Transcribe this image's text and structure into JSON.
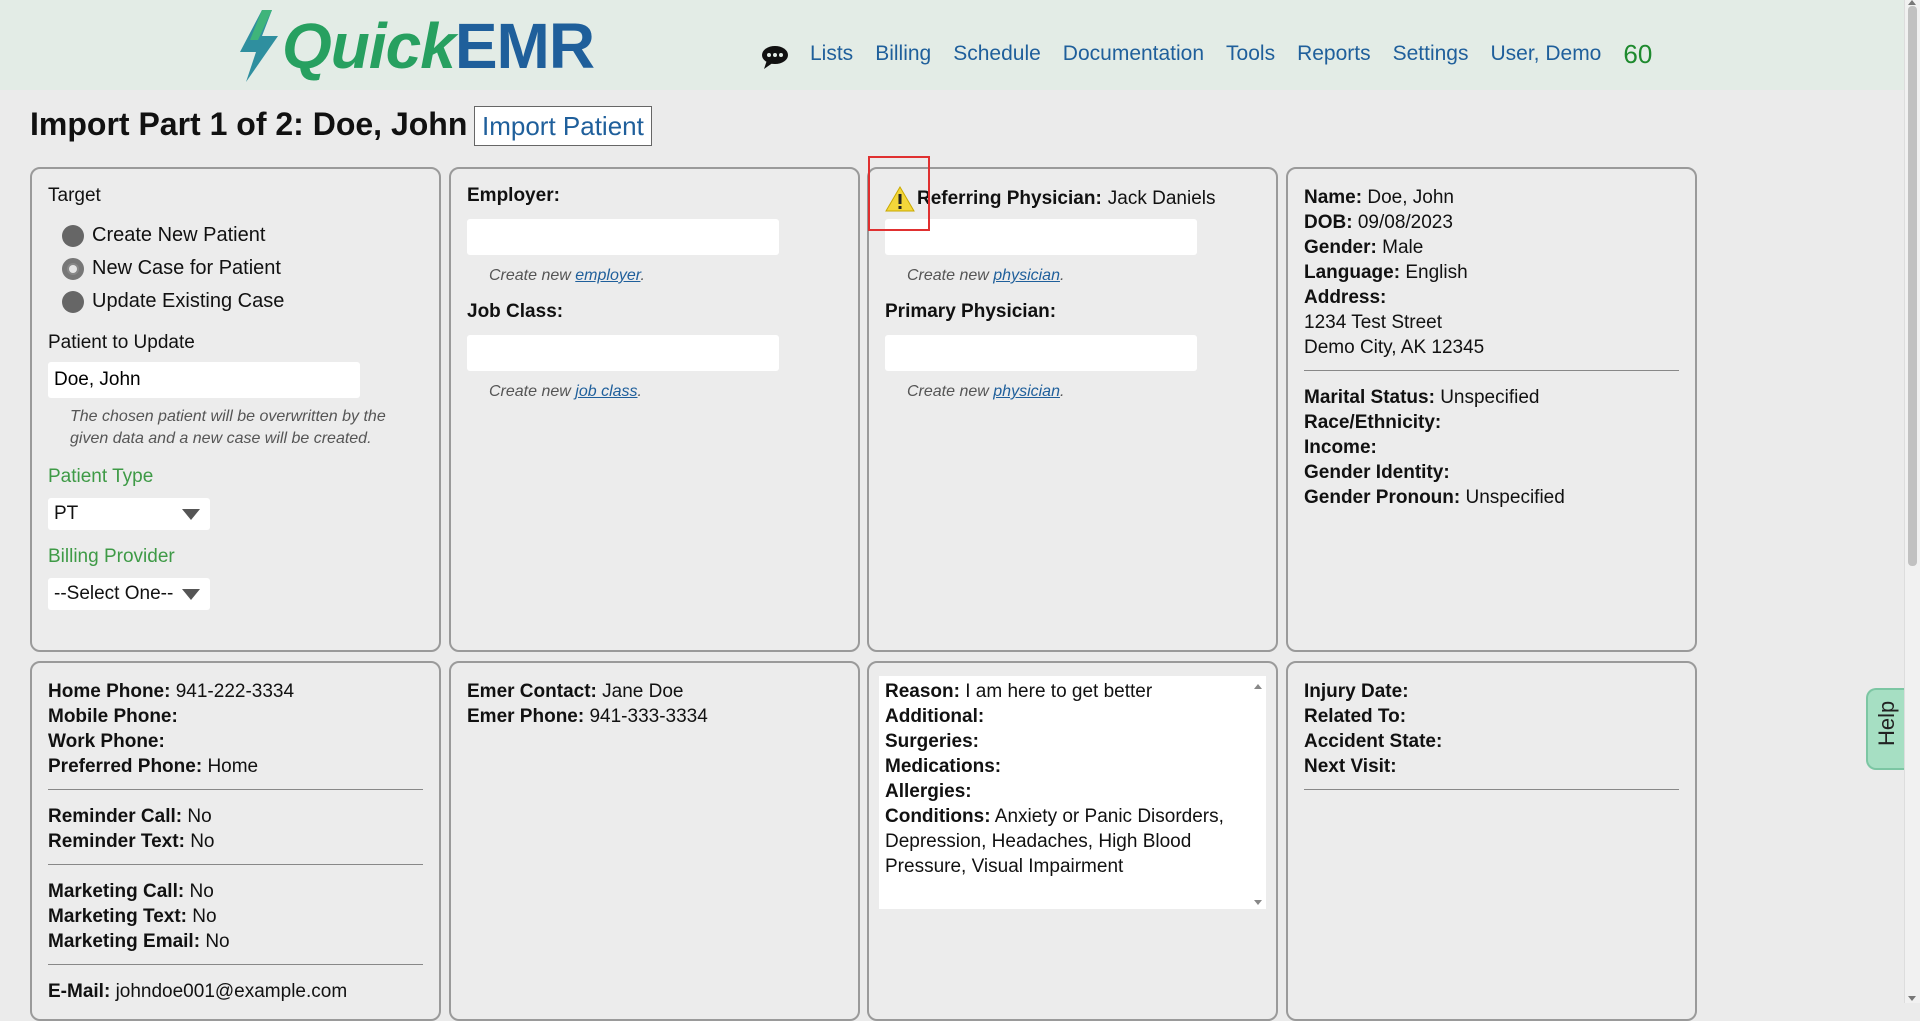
{
  "header": {
    "logo_quick": "Quick",
    "logo_emr": "EMR",
    "nav": [
      "Lists",
      "Billing",
      "Schedule",
      "Documentation",
      "Tools",
      "Reports",
      "Settings",
      "User, Demo"
    ],
    "count": "60"
  },
  "page": {
    "title": "Import Part 1 of 2: Doe, John",
    "import_button": "Import Patient"
  },
  "target": {
    "label": "Target",
    "options": [
      "Create New Patient",
      "New Case for Patient",
      "Update Existing Case"
    ],
    "selected": "New Case for Patient",
    "patient_label": "Patient to Update",
    "patient_value": "Doe, John",
    "hint": "The chosen patient will be overwritten by the given data and a new case will be created.",
    "patient_type_label": "Patient Type",
    "patient_type_value": "PT",
    "billing_label": "Billing Provider",
    "billing_value": "--Select One--"
  },
  "employer": {
    "employer_label": "Employer:",
    "employer_hint_prefix": "Create new ",
    "employer_hint_link": "employer",
    "job_label": "Job Class:",
    "job_hint_prefix": "Create new ",
    "job_hint_link": "job class"
  },
  "physician": {
    "referring_label": "Referring Physician:",
    "referring_value": "Jack Daniels",
    "hint_prefix": "Create new ",
    "hint_link": "physician",
    "primary_label": "Primary Physician:"
  },
  "demographics": {
    "name_label": "Name:",
    "name": "Doe, John",
    "dob_label": "DOB:",
    "dob": "09/08/2023",
    "gender_label": "Gender:",
    "gender": "Male",
    "language_label": "Language:",
    "language": "English",
    "address_label": "Address:",
    "address1": "1234 Test Street",
    "address2": "Demo City, AK 12345",
    "marital_label": "Marital Status:",
    "marital": "Unspecified",
    "race_label": "Race/Ethnicity:",
    "income_label": "Income:",
    "gender_identity_label": "Gender Identity:",
    "pronoun_label": "Gender Pronoun:",
    "pronoun": "Unspecified"
  },
  "contact": {
    "home_label": "Home Phone:",
    "home": "941-222-3334",
    "mobile_label": "Mobile Phone:",
    "work_label": "Work Phone:",
    "preferred_label": "Preferred Phone:",
    "preferred": "Home",
    "rem_call_label": "Reminder Call:",
    "rem_call": "No",
    "rem_text_label": "Reminder Text:",
    "rem_text": "No",
    "mkt_call_label": "Marketing Call:",
    "mkt_call": "No",
    "mkt_text_label": "Marketing Text:",
    "mkt_text": "No",
    "mkt_email_label": "Marketing Email:",
    "mkt_email": "No",
    "email_label": "E-Mail:",
    "email": "johndoe001@example.com"
  },
  "emergency": {
    "contact_label": "Emer Contact:",
    "contact": "Jane Doe",
    "phone_label": "Emer Phone:",
    "phone": "941-333-3334"
  },
  "medical": {
    "reason_label": "Reason:",
    "reason": "I am here to get better",
    "additional_label": "Additional:",
    "surgeries_label": "Surgeries:",
    "medications_label": "Medications:",
    "allergies_label": "Allergies:",
    "conditions_label": "Conditions:",
    "conditions": "Anxiety or Panic Disorders, Depression, Headaches, High Blood Pressure, Visual Impairment"
  },
  "injury": {
    "date_label": "Injury Date:",
    "related_label": "Related To:",
    "state_label": "Accident State:",
    "next_label": "Next Visit:"
  },
  "help": {
    "label": "Help"
  },
  "colors": {
    "header_bg": "#e3ece6",
    "link": "#1f5f9b",
    "brand_green": "#27a060",
    "label_green": "#3e9a46",
    "highlight": "#e03030"
  }
}
